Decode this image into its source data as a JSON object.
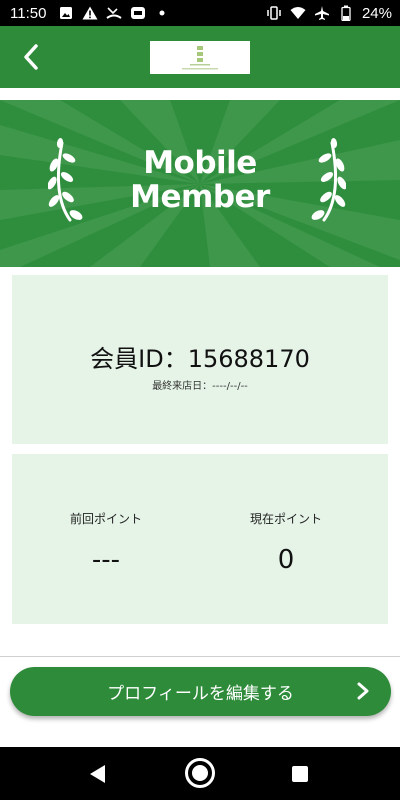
{
  "status_bar": {
    "time": "11:50",
    "battery": "24%",
    "left_icons": [
      "image-icon",
      "warning-icon",
      "missed-call-icon",
      "app-notification-icon",
      "dot-icon"
    ],
    "right_icons": [
      "vibrate-icon",
      "wifi-icon",
      "airplane-icon",
      "battery-icon"
    ]
  },
  "app_bar": {
    "back_icon": "chevron-left-icon",
    "logo": "brand-logo"
  },
  "banner": {
    "title_line1": "Mobile",
    "title_line2": "Member"
  },
  "member_card": {
    "member_id": "会員ID：15688170",
    "last_visit": "最終来店日：----/--/--"
  },
  "points_card": {
    "previous_label": "前回ポイント",
    "previous_value": "---",
    "current_label": "現在ポイント",
    "current_value": "0"
  },
  "edit_button": {
    "label": "プロフィールを編集する"
  },
  "colors": {
    "primary": "#2e8b3a",
    "card_bg": "#e6f4e8"
  }
}
